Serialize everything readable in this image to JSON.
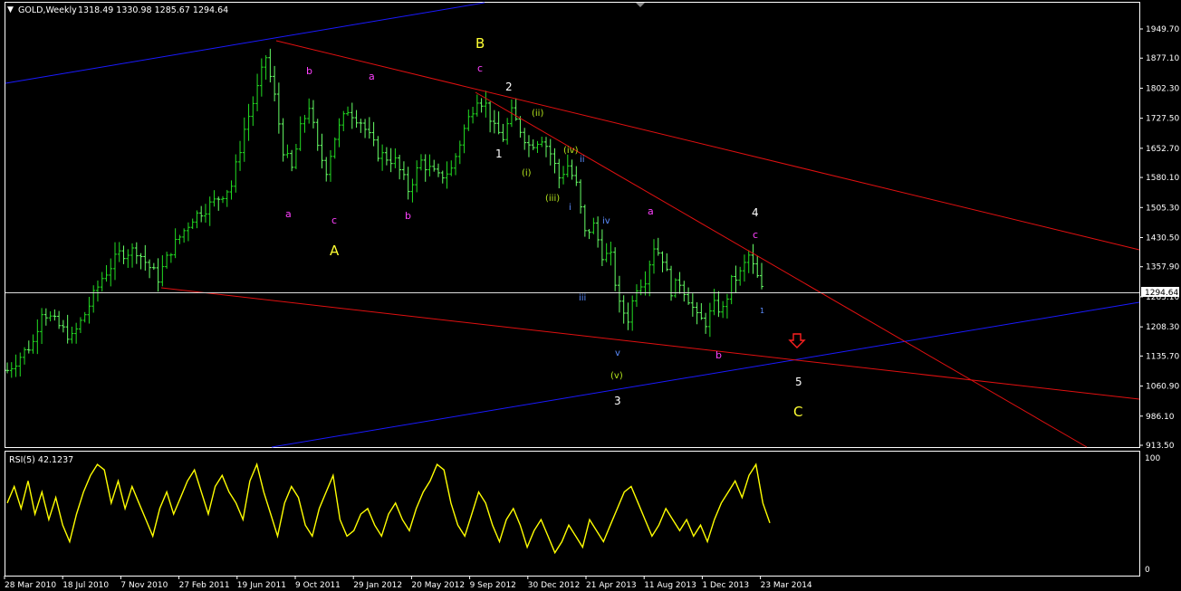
{
  "window": {
    "menu_arrow": "▼",
    "title_symbol": "GOLD,Weekly",
    "ohlc": "1318.49 1330.98 1285.67 1294.64"
  },
  "colors": {
    "background": "#000000",
    "frame": "#ffffff",
    "bar_up": "#22dd22",
    "bar_down": "#66ff66",
    "channel_blue": "#1a1aff",
    "trend_red": "#e01010",
    "current_price_line": "#ffffff",
    "wave_magenta": "#ff40ff",
    "wave_yellow": "#ffff33",
    "wave_white": "#ffffff",
    "wave_green": "#b5e61d",
    "wave_blue": "#5b8cff",
    "arrow_red": "#ff2020",
    "rsi_line": "#ffff00"
  },
  "chart_data": [
    {
      "type": "candlestick",
      "symbol": "GOLD",
      "timeframe": "Weekly",
      "ylim": [
        875,
        2010
      ],
      "y_ticks": [
        "1949.70",
        "1877.10",
        "1802.30",
        "1727.50",
        "1652.70",
        "1580.10",
        "1505.30",
        "1430.50",
        "1357.90",
        "1283.10",
        "1208.30",
        "1135.70",
        "1060.90",
        "986.10",
        "913.50"
      ],
      "current_price": "1294.64",
      "x_ticks": [
        "28 Mar 2010",
        "18 Jul 2010",
        "7 Nov 2010",
        "27 Feb 2011",
        "19 Jun 2011",
        "9 Oct 2011",
        "29 Jan 2012",
        "20 May 2012",
        "9 Sep 2012",
        "30 Dec 2012",
        "21 Apr 2013",
        "11 Aug 2013",
        "1 Dec 2013",
        "23 Mar 2014"
      ],
      "price_path": [
        [
          0,
          1100
        ],
        [
          6,
          1170
        ],
        [
          8,
          1250
        ],
        [
          13,
          1200
        ],
        [
          15,
          1180
        ],
        [
          18,
          1240
        ],
        [
          22,
          1330
        ],
        [
          26,
          1390
        ],
        [
          30,
          1400
        ],
        [
          32,
          1370
        ],
        [
          35,
          1330
        ],
        [
          38,
          1400
        ],
        [
          43,
          1480
        ],
        [
          48,
          1520
        ],
        [
          52,
          1560
        ],
        [
          55,
          1700
        ],
        [
          58,
          1800
        ],
        [
          60,
          1880
        ],
        [
          62,
          1780
        ],
        [
          64,
          1650
        ],
        [
          66,
          1600
        ],
        [
          68,
          1700
        ],
        [
          70,
          1760
        ],
        [
          72,
          1650
        ],
        [
          74,
          1600
        ],
        [
          76,
          1680
        ],
        [
          79,
          1750
        ],
        [
          82,
          1720
        ],
        [
          86,
          1640
        ],
        [
          90,
          1620
        ],
        [
          93,
          1550
        ],
        [
          96,
          1620
        ],
        [
          100,
          1580
        ],
        [
          103,
          1600
        ],
        [
          106,
          1700
        ],
        [
          109,
          1780
        ],
        [
          111,
          1760
        ],
        [
          113,
          1700
        ],
        [
          115,
          1680
        ],
        [
          117,
          1740
        ],
        [
          119,
          1700
        ],
        [
          121,
          1660
        ],
        [
          124,
          1680
        ],
        [
          126,
          1640
        ],
        [
          128,
          1580
        ],
        [
          130,
          1610
        ],
        [
          132,
          1560
        ],
        [
          134,
          1440
        ],
        [
          136,
          1460
        ],
        [
          138,
          1390
        ],
        [
          140,
          1380
        ],
        [
          142,
          1260
        ],
        [
          144,
          1230
        ],
        [
          146,
          1310
        ],
        [
          148,
          1330
        ],
        [
          150,
          1410
        ],
        [
          152,
          1380
        ],
        [
          154,
          1300
        ],
        [
          156,
          1320
        ],
        [
          158,
          1280
        ],
        [
          160,
          1230
        ],
        [
          162,
          1220
        ],
        [
          164,
          1260
        ],
        [
          166,
          1250
        ],
        [
          168,
          1320
        ],
        [
          170,
          1340
        ],
        [
          172,
          1385
        ],
        [
          174,
          1330
        ],
        [
          175,
          1300
        ]
      ],
      "annotations": [
        {
          "text": "B",
          "color": "wave_yellow"
        },
        {
          "text": "A",
          "color": "wave_yellow"
        },
        {
          "text": "C",
          "color": "wave_yellow"
        },
        {
          "text": "a",
          "color": "wave_magenta"
        },
        {
          "text": "b",
          "color": "wave_magenta"
        },
        {
          "text": "c",
          "color": "wave_magenta"
        },
        {
          "text": "1",
          "color": "wave_white"
        },
        {
          "text": "2",
          "color": "wave_white"
        },
        {
          "text": "3",
          "color": "wave_white"
        },
        {
          "text": "4",
          "color": "wave_white"
        },
        {
          "text": "5",
          "color": "wave_white"
        },
        {
          "text": "(i)",
          "color": "wave_green"
        },
        {
          "text": "(ii)",
          "color": "wave_green"
        },
        {
          "text": "(iii)",
          "color": "wave_green"
        },
        {
          "text": "(iv)",
          "color": "wave_green"
        },
        {
          "text": "(v)",
          "color": "wave_green"
        },
        {
          "text": "i",
          "color": "wave_blue"
        },
        {
          "text": "ii",
          "color": "wave_blue"
        },
        {
          "text": "iii",
          "color": "wave_blue"
        },
        {
          "text": "iv",
          "color": "wave_blue"
        },
        {
          "text": "v",
          "color": "wave_blue"
        }
      ]
    },
    {
      "type": "line",
      "indicator": "RSI(5)",
      "label": "RSI(5) 42.1237",
      "ylim": [
        0,
        100
      ],
      "y_ticks": [
        "100",
        "0"
      ],
      "values": [
        60,
        75,
        55,
        80,
        50,
        70,
        45,
        65,
        40,
        25,
        50,
        70,
        85,
        95,
        90,
        60,
        80,
        55,
        75,
        60,
        45,
        30,
        55,
        70,
        50,
        65,
        80,
        90,
        70,
        50,
        75,
        85,
        70,
        60,
        45,
        80,
        95,
        70,
        50,
        30,
        60,
        75,
        65,
        40,
        30,
        55,
        70,
        85,
        45,
        30,
        35,
        50,
        55,
        40,
        30,
        50,
        60,
        45,
        35,
        55,
        70,
        80,
        95,
        90,
        60,
        40,
        30,
        50,
        70,
        60,
        40,
        25,
        45,
        55,
        40,
        20,
        35,
        45,
        30,
        15,
        25,
        40,
        30,
        20,
        45,
        35,
        25,
        40,
        55,
        70,
        75,
        60,
        45,
        30,
        40,
        55,
        45,
        35,
        45,
        30,
        40,
        25,
        45,
        60,
        70,
        80,
        65,
        85,
        95,
        60,
        42
      ]
    }
  ]
}
